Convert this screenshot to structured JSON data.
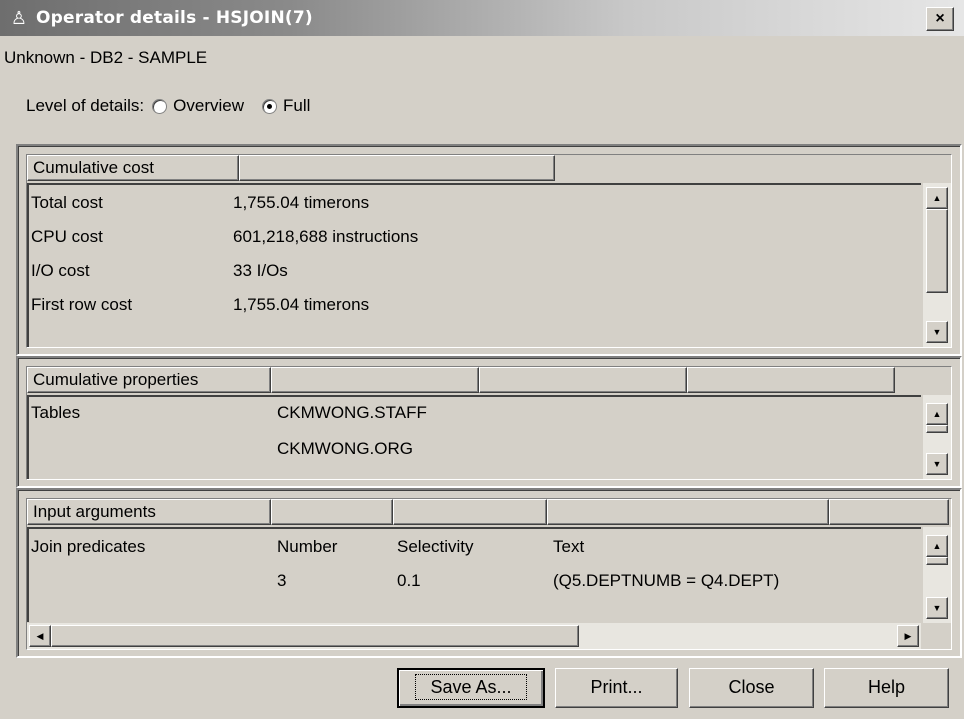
{
  "window": {
    "title": "Operator details - HSJOIN(7)",
    "close_label": "×",
    "title_icon": "operator-people-icon"
  },
  "subtitle": "Unknown - DB2 - SAMPLE",
  "level": {
    "label": "Level of details:",
    "options": [
      {
        "label": "Overview",
        "checked": false
      },
      {
        "label": "Full",
        "checked": true
      }
    ]
  },
  "cumulative_cost": {
    "header": "Cumulative cost",
    "rows": [
      {
        "name": "Total cost",
        "value": "1,755.04 timerons"
      },
      {
        "name": "CPU cost",
        "value": "601,218,688 instructions"
      },
      {
        "name": "I/O cost",
        "value": "33 I/Os"
      },
      {
        "name": "First row cost",
        "value": "1,755.04 timerons"
      }
    ]
  },
  "cumulative_properties": {
    "header": "Cumulative properties",
    "rows": [
      {
        "name": "Tables",
        "value": "CKMWONG.STAFF"
      },
      {
        "name": "",
        "value": "CKMWONG.ORG"
      }
    ]
  },
  "input_arguments": {
    "header": "Input arguments",
    "columns": [
      "Join predicates",
      "Number",
      "Selectivity",
      "Text"
    ],
    "rows": [
      {
        "c1": "",
        "number": "3",
        "selectivity": "0.1",
        "text": "(Q5.DEPTNUMB = Q4.DEPT)"
      }
    ]
  },
  "buttons": {
    "save_as": "Save As...",
    "print": "Print...",
    "close": "Close",
    "help": "Help"
  }
}
